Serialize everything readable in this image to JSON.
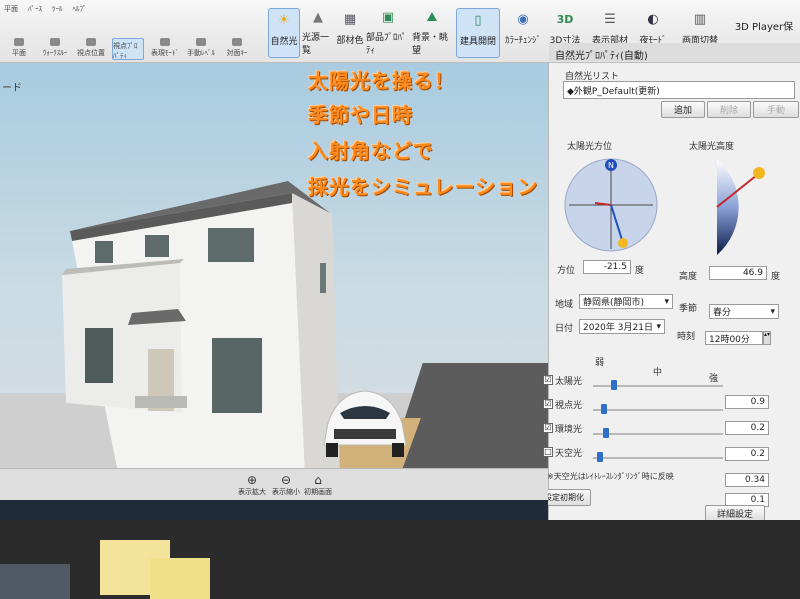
{
  "toolbar": {
    "row1": [
      "平面",
      "ﾊﾟｰｽ",
      "ﾂｰﾙ",
      "ﾍﾙﾌﾟ"
    ],
    "row2": [
      "平面",
      "ｳｫｰｸｽﾙｰ",
      "視点位置",
      "視点ﾌﾟﾛﾊﾟﾃｨ",
      "表現ﾓｰﾄﾞ",
      "手動ﾚﾍﾞﾙ",
      "対面ｷｰ"
    ],
    "buttons": [
      {
        "label": "自然光"
      },
      {
        "label": "光源一覧"
      },
      {
        "label": "部材色"
      },
      {
        "label": "部品ﾌﾟﾛﾊﾟﾃｨ"
      },
      {
        "label": "背景・眺望"
      },
      {
        "label": "建具開閉"
      },
      {
        "label": "ｶﾗｰﾁｪﾝｼﾞ"
      },
      {
        "label": "3D寸法"
      },
      {
        "label": "表示部材"
      },
      {
        "label": "夜ﾓｰﾄﾞ"
      },
      {
        "label": "画面切替"
      },
      {
        "label": "3D Player保"
      }
    ]
  },
  "viewport": {
    "title": "ード",
    "annotation_lines": [
      "太陽光を操る！",
      "季節や日時",
      "入射角などで",
      "採光をシミュレーション"
    ]
  },
  "panel": {
    "title": "自然光ﾌﾟﾛﾊﾟﾃｨ(自動)",
    "list_label": "自然光リスト",
    "list_item": "◆外観P_Default(更新)",
    "add_button": "追加",
    "delete_button": "削除",
    "edit_button": "手動",
    "sun_azimuth_label": "太陽光方位",
    "sun_altitude_label": "太陽光高度",
    "compass_north": "N",
    "azimuth_label": "方位",
    "azimuth_value": "-21.5",
    "azimuth_unit": "度",
    "altitude_label": "高度",
    "altitude_value": "46.9",
    "altitude_unit": "度",
    "region_label": "地域",
    "region_value": "静岡県(静岡市)",
    "season_label": "季節",
    "season_value": "春分",
    "date_label": "日付",
    "date_value": "2020年 3月21日",
    "time_label": "時刻",
    "time_value": "12時00分",
    "scale_weak": "弱",
    "scale_mid": "中",
    "scale_strong": "強",
    "lights": [
      {
        "label": "太陽光",
        "checked": "☑",
        "value": "0.9",
        "level": 0.3
      },
      {
        "label": "視点光",
        "checked": "☑",
        "value": "0.2",
        "level": 0.05
      },
      {
        "label": "環境光",
        "checked": "☑",
        "value": "0.2",
        "level": 0.05
      },
      {
        "label": "天空光",
        "checked": "□",
        "value": "0.34",
        "level": 0.0
      }
    ],
    "sky_value": "0.1",
    "note": "※天空光はﾚｲﾄﾚｰｽﾚﾝﾀﾞﾘﾝｸﾞ時に反映",
    "reset_button": "設定初期化",
    "detail_button": "詳細設定"
  },
  "bottom": {
    "buttons": [
      "表示拡大",
      "表示縮小",
      "初期画面"
    ]
  }
}
